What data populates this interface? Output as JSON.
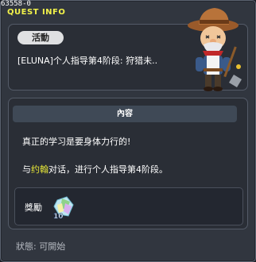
{
  "window": {
    "quest_id": "63558-0",
    "title": "QUEST INFO"
  },
  "quest": {
    "category_badge": "活動",
    "name": "[ELUNA]个人指导第4阶段: 狩猎未..",
    "npc_icon": "cowboy-npc-icon"
  },
  "content": {
    "header": "內容",
    "line1": "真正的学习是要身体力行的!",
    "line2_prefix": "与",
    "line2_npc": "约翰",
    "line2_suffix": "对话，进行个人指导第4阶段。"
  },
  "reward": {
    "label": "獎勵",
    "item_icon": "crystal-reward-icon",
    "item_count": "10"
  },
  "status": {
    "text": "狀態: 可開始"
  },
  "colors": {
    "title": "#f2f24a",
    "npc_link": "#e8e838",
    "panel": "#2a2e36",
    "window": "#31363f"
  }
}
